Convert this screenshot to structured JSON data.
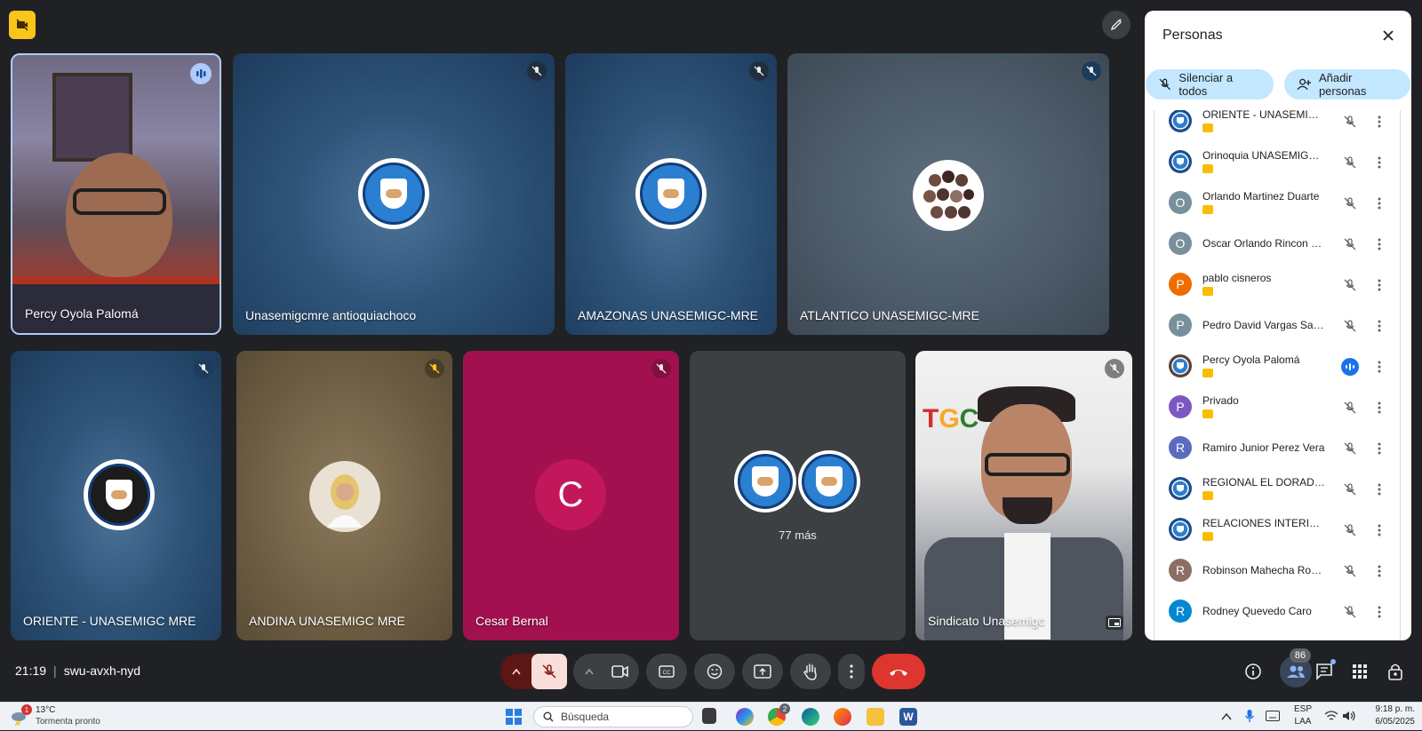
{
  "meeting": {
    "time": "21:19",
    "code": "swu-avxh-nyd",
    "people_count": "86"
  },
  "tiles": [
    {
      "name": "Percy Oyola Palomá"
    },
    {
      "name": "Unasemigcmre antioquiachoco"
    },
    {
      "name": "AMAZONAS UNASEMIGC-MRE"
    },
    {
      "name": "ATLANTICO UNASEMIGC-MRE"
    },
    {
      "name": "ORIENTE - UNASEMIGC MRE"
    },
    {
      "name": "ANDINA UNASEMIGC MRE"
    },
    {
      "name": "Cesar Bernal",
      "initial": "C"
    },
    {
      "name": "77 más"
    },
    {
      "name": "Sindicato Unasemigc"
    }
  ],
  "panel": {
    "title": "Personas",
    "mute_all": "Silenciar a todos",
    "add_people": "Añadir personas",
    "participants": [
      {
        "name": "ORIENTE - UNASEMIGC ...",
        "avatar": "",
        "color": "#1a4e8a",
        "host": true,
        "speaking": false
      },
      {
        "name": "Orinoquia UNASEMIGC-...",
        "avatar": "",
        "color": "#1a4e8a",
        "host": true,
        "speaking": false
      },
      {
        "name": "Orlando Martinez Duarte",
        "avatar": "O",
        "color": "#78909c",
        "host": true,
        "speaking": false
      },
      {
        "name": "Oscar Orlando Rincon C...",
        "avatar": "O",
        "color": "#78909c",
        "host": false,
        "speaking": false
      },
      {
        "name": "pablo cisneros",
        "avatar": "P",
        "color": "#ef6c00",
        "host": true,
        "speaking": false
      },
      {
        "name": "Pedro David Vargas Sant...",
        "avatar": "P",
        "color": "#78909c",
        "host": false,
        "speaking": false
      },
      {
        "name": "Percy Oyola Palomá",
        "avatar": "",
        "color": "#5d4037",
        "host": true,
        "speaking": true
      },
      {
        "name": "Privado",
        "avatar": "P",
        "color": "#7e57c2",
        "host": true,
        "speaking": false
      },
      {
        "name": "Ramiro Junior Perez Vera",
        "avatar": "R",
        "color": "#5c6bc0",
        "host": false,
        "speaking": false
      },
      {
        "name": "REGIONAL EL DORADO ...",
        "avatar": "",
        "color": "#1a4e8a",
        "host": true,
        "speaking": false
      },
      {
        "name": "RELACIONES INTERINSTI...",
        "avatar": "",
        "color": "#1a4e8a",
        "host": true,
        "speaking": false
      },
      {
        "name": "Robinson Mahecha Rond...",
        "avatar": "R",
        "color": "#8d6e63",
        "host": false,
        "speaking": false
      },
      {
        "name": "Rodney Quevedo Caro",
        "avatar": "R",
        "color": "#0288d1",
        "host": false,
        "speaking": false
      }
    ]
  },
  "taskbar": {
    "temperature": "13°C",
    "weather": "Tormenta pronto",
    "weather_badge": "1",
    "search_placeholder": "Búsqueda",
    "lang_1": "ESP",
    "lang_2": "LAA",
    "clock_time": "9:18 p. m.",
    "clock_date": "6/05/2025",
    "chrome_badge": "2"
  }
}
